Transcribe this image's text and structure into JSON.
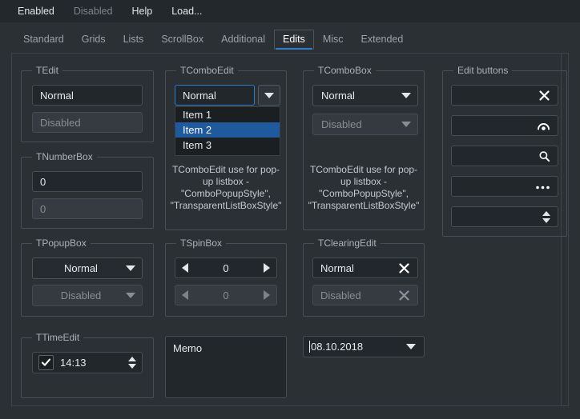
{
  "menu": {
    "items": [
      {
        "label": "Enabled",
        "enabled": true
      },
      {
        "label": "Disabled",
        "enabled": false
      },
      {
        "label": "Help",
        "enabled": true
      },
      {
        "label": "Load...",
        "enabled": true
      }
    ]
  },
  "tabs": {
    "items": [
      {
        "label": "Standard"
      },
      {
        "label": "Grids"
      },
      {
        "label": "Lists"
      },
      {
        "label": "ScrollBox"
      },
      {
        "label": "Additional"
      },
      {
        "label": "Edits"
      },
      {
        "label": "Misc"
      },
      {
        "label": "Extended"
      }
    ],
    "active": "Edits"
  },
  "groups": {
    "tedit": {
      "title": "TEdit",
      "normal_value": "Normal",
      "disabled_value": "Disabled"
    },
    "tnumberbox": {
      "title": "TNumberBox",
      "normal_value": "0",
      "disabled_value": "0"
    },
    "tpopupbox": {
      "title": "TPopupBox",
      "normal_value": "Normal",
      "disabled_value": "Disabled"
    },
    "ttimeedit": {
      "title": "TTimeEdit",
      "value": "14:13",
      "checked": true
    },
    "tcomboedit": {
      "title": "TComboEdit",
      "value": "Normal",
      "dropdown_items": [
        "Item 1",
        "Item 2",
        "Item 3"
      ],
      "selected_item": "Item 2",
      "note": "TComboEdit use for pop-up listbox - \"ComboPopupStyle\", \"TransparentListBoxStyle\""
    },
    "tspinbox": {
      "title": "TSpinBox",
      "normal_value": "0",
      "disabled_value": "0"
    },
    "tcombobox": {
      "title": "TComboBox",
      "normal_value": "Normal",
      "disabled_value": "Disabled",
      "note": "TComboEdit use for pop-up listbox - \"ComboPopupStyle\", \"TransparentListBoxStyle\""
    },
    "tclearingedit": {
      "title": "TClearingEdit",
      "normal_value": "Normal",
      "disabled_value": "Disabled"
    },
    "editbuttons": {
      "title": "Edit buttons",
      "rows": [
        {
          "value": "",
          "icon": "clear-icon"
        },
        {
          "value": "",
          "icon": "password-reveal-icon"
        },
        {
          "value": "",
          "icon": "search-icon"
        },
        {
          "value": "",
          "icon": "ellipsis-icon"
        },
        {
          "value": "",
          "icon": "updown-icon"
        }
      ]
    }
  },
  "memo": {
    "value": "Memo"
  },
  "datebox": {
    "value": "08.10.2018"
  },
  "colors": {
    "background": "#2b3034",
    "menubar": "#23282c",
    "accent": "#2f7fd1",
    "selection": "#1f5a9e",
    "field": "#22272b",
    "field_disabled": "#353b40",
    "border": "#474f55",
    "text": "#e6eaee",
    "text_dim": "#868e95"
  }
}
